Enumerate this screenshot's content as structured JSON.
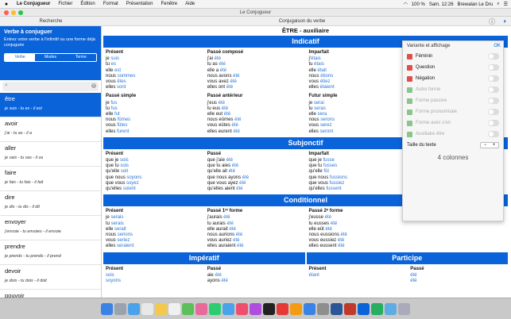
{
  "menubar": {
    "apple": "",
    "app": "Le Conjugueur",
    "items": [
      "Fichier",
      "Édition",
      "Format",
      "Présentation",
      "Fenêtre",
      "Aide"
    ],
    "battery": "100 %",
    "clock": "Sam. 12:26",
    "user": "Brewalan Le Dru"
  },
  "window": {
    "title": "Le Conjugueur"
  },
  "sidebar": {
    "header": "Recherche",
    "panel_title": "Verbe à conjuguer",
    "panel_hint": "Entrez votre verbe à l'infinitif ou une forme déjà conjuguée",
    "segments": [
      "Verbe",
      "Modes",
      "Terme"
    ],
    "search_placeholder": "",
    "verbs": [
      {
        "v": "être",
        "f": "je suis - tu es - il est",
        "sel": true
      },
      {
        "v": "avoir",
        "f": "j'ai - tu as - il a"
      },
      {
        "v": "aller",
        "f": "je vais - tu vas - il va"
      },
      {
        "v": "faire",
        "f": "je fais - tu fais - il fait"
      },
      {
        "v": "dire",
        "f": "je dis - tu dis - il dit"
      },
      {
        "v": "envoyer",
        "f": "j'envoie - tu envoies - il envoie"
      },
      {
        "v": "prendre",
        "f": "je prends - tu prends - il prend"
      },
      {
        "v": "devoir",
        "f": "je dois - tu dois - il doit"
      },
      {
        "v": "pouvoir",
        "f": "je peux - tu peux - il peut"
      }
    ]
  },
  "main": {
    "header": "Conjugaison du verbe",
    "verb_title": "ÊTRE - auxiliaire",
    "indicatif": "Indicatif",
    "subjonctif": "Subjonctif",
    "conditionnel": "Conditionnel",
    "imperatif": "Impératif",
    "participe": "Participe",
    "tenses": {
      "ind_present": {
        "h": "Présent",
        "rows": [
          [
            "je ",
            "suis"
          ],
          [
            "tu ",
            "es"
          ],
          [
            "elle ",
            "est"
          ],
          [
            "nous ",
            "sommes"
          ],
          [
            "vous ",
            "êtes"
          ],
          [
            "elles ",
            "sont"
          ]
        ]
      },
      "ind_pc": {
        "h": "Passé composé",
        "rows": [
          [
            "j'ai ",
            "été"
          ],
          [
            "tu as ",
            "été"
          ],
          [
            "elle a ",
            "été"
          ],
          [
            "nous avons ",
            "été"
          ],
          [
            "vous avez ",
            "été"
          ],
          [
            "elles ont ",
            "été"
          ]
        ]
      },
      "ind_imp": {
        "h": "Imparfait",
        "rows": [
          [
            "j'",
            "étais"
          ],
          [
            "tu ",
            "étais"
          ],
          [
            "elle ",
            "était"
          ],
          [
            "nous ",
            "étions"
          ],
          [
            "vous ",
            "étiez"
          ],
          [
            "elles ",
            "étaient"
          ]
        ]
      },
      "ind_ps": {
        "h": "Passé simple",
        "rows": [
          [
            "je ",
            "fus"
          ],
          [
            "tu ",
            "fus"
          ],
          [
            "elle ",
            "fut"
          ],
          [
            "nous ",
            "fûmes"
          ],
          [
            "vous ",
            "fûtes"
          ],
          [
            "elles ",
            "furent"
          ]
        ]
      },
      "ind_pa": {
        "h": "Passé antérieur",
        "rows": [
          [
            "j'eus ",
            "été"
          ],
          [
            "tu eus ",
            "été"
          ],
          [
            "elle eut ",
            "été"
          ],
          [
            "nous eûmes ",
            "été"
          ],
          [
            "vous eûtes ",
            "été"
          ],
          [
            "elles eurent ",
            "été"
          ]
        ]
      },
      "ind_fs": {
        "h": "Futur simple",
        "rows": [
          [
            "je ",
            "serai"
          ],
          [
            "tu ",
            "seras"
          ],
          [
            "elle ",
            "sera"
          ],
          [
            "nous ",
            "serons"
          ],
          [
            "vous ",
            "serez"
          ],
          [
            "elles ",
            "seront"
          ]
        ]
      },
      "sub_present": {
        "h": "Présent",
        "rows": [
          [
            "que je ",
            "sois"
          ],
          [
            "que tu ",
            "sois"
          ],
          [
            "qu'elle ",
            "soit"
          ],
          [
            "que nous ",
            "soyons"
          ],
          [
            "que vous ",
            "soyez"
          ],
          [
            "qu'elles ",
            "soient"
          ]
        ]
      },
      "sub_passe": {
        "h": "Passé",
        "rows": [
          [
            "que j'aie ",
            "été"
          ],
          [
            "que tu aies ",
            "été"
          ],
          [
            "qu'elle ait ",
            "été"
          ],
          [
            "que nous ayons ",
            "été"
          ],
          [
            "que vous ayez ",
            "été"
          ],
          [
            "qu'elles aient ",
            "été"
          ]
        ]
      },
      "sub_imp": {
        "h": "Imparfait",
        "rows": [
          [
            "que je ",
            "fusse"
          ],
          [
            "que tu ",
            "fusses"
          ],
          [
            "qu'elle ",
            "fût"
          ],
          [
            "que nous ",
            "fussions"
          ],
          [
            "que vous ",
            "fussiez"
          ],
          [
            "qu'elles ",
            "fussent"
          ]
        ]
      },
      "cond_present": {
        "h": "Présent",
        "rows": [
          [
            "je ",
            "serais"
          ],
          [
            "tu ",
            "serais"
          ],
          [
            "elle ",
            "serait"
          ],
          [
            "nous ",
            "serions"
          ],
          [
            "vous ",
            "seriez"
          ],
          [
            "elles ",
            "seraient"
          ]
        ]
      },
      "cond_p1": {
        "h": "Passé 1ʳᵉ forme",
        "rows": [
          [
            "j'aurais ",
            "été"
          ],
          [
            "tu aurais ",
            "été"
          ],
          [
            "elle aurait ",
            "été"
          ],
          [
            "nous aurions ",
            "été"
          ],
          [
            "vous auriez ",
            "été"
          ],
          [
            "elles auraient ",
            "été"
          ]
        ]
      },
      "cond_p2": {
        "h": "Passé 2ᵉ forme",
        "rows": [
          [
            "j'eusse ",
            "été"
          ],
          [
            "tu eusses ",
            "été"
          ],
          [
            "elle eût ",
            "été"
          ],
          [
            "nous eussions ",
            "été"
          ],
          [
            "vous eussiez ",
            "été"
          ],
          [
            "elles eussent ",
            "été"
          ]
        ]
      },
      "imp_present": {
        "h": "Présent",
        "rows": [
          [
            "",
            "sois"
          ],
          [
            "",
            "soyons"
          ]
        ]
      },
      "imp_passe": {
        "h": "Passé",
        "rows": [
          [
            "aie ",
            "été"
          ],
          [
            "ayons ",
            "été"
          ]
        ]
      },
      "part_present": {
        "h": "Présent",
        "rows": [
          [
            "",
            "étant"
          ]
        ]
      },
      "part_passe": {
        "h": "Passé",
        "rows": [
          [
            "",
            "été"
          ],
          [
            "",
            "été"
          ]
        ]
      }
    }
  },
  "options": {
    "title": "Variante et affichage",
    "ok": "OK",
    "rows": [
      {
        "label": "Féminin",
        "color": "#e0504a",
        "dim": false
      },
      {
        "label": "Question",
        "color": "#e0504a",
        "dim": false
      },
      {
        "label": "Négation",
        "color": "#e0504a",
        "dim": false
      },
      {
        "label": "Autre forme",
        "color": "#8bc58b",
        "dim": true
      },
      {
        "label": "Forme passive",
        "color": "#8bc58b",
        "dim": true
      },
      {
        "label": "Forme pronominale",
        "color": "#8bc58b",
        "dim": true
      },
      {
        "label": "Forme avec s'en",
        "color": "#8bc58b",
        "dim": true
      },
      {
        "label": "Auxiliaire être",
        "color": "#8bc58b",
        "dim": true
      }
    ],
    "text_size": "Taille du texte",
    "minus": "−",
    "plus": "+",
    "columns": "4 colonnes"
  },
  "colors": {
    "accent": "#0a63d9",
    "link": "#2a74d8"
  }
}
